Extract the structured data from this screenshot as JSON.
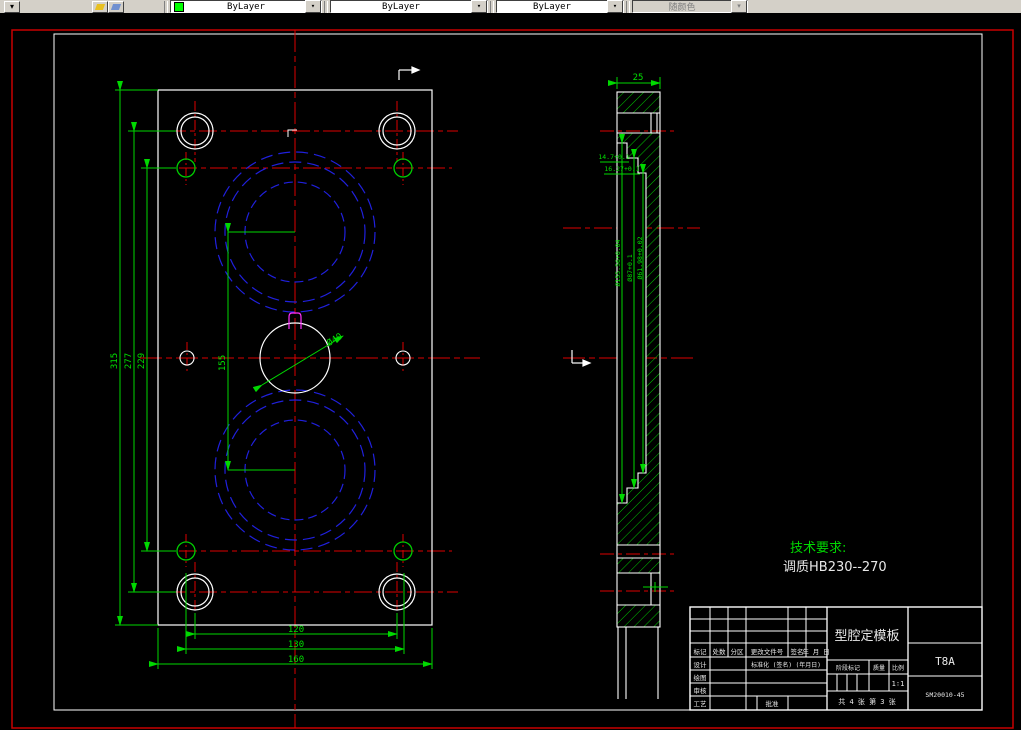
{
  "toolbar": {
    "color_combo": {
      "value": "ByLayer",
      "swatch_color": "#00ff00"
    },
    "linetype_combo": {
      "value": "ByLayer"
    },
    "lineweight_combo": {
      "value": "ByLayer"
    },
    "plotstyle_combo": {
      "value": "随颜色"
    },
    "dropdown_glyph": "▾"
  },
  "drawing": {
    "tech_requirements": {
      "title": "技术要求:",
      "line1": "调质HB230--270"
    },
    "front_view": {
      "dims": {
        "height_overall": "315",
        "height_holes": "277",
        "height_inner": "229",
        "cavity_spacing": "155",
        "width_holes": "120",
        "width_inner": "130",
        "width_overall": "160",
        "center_hole_dia": "Ø40"
      }
    },
    "side_view": {
      "dims": {
        "thickness": "25",
        "depth1": "14.7+0.1",
        "depth2": "16.27+0.1",
        "bore1": "Ø155.56+0.04",
        "bore2": "Ø87+0.1",
        "bore3": "Ø61.98+0.02"
      }
    },
    "title_block": {
      "title": "型腔定模板",
      "material": "T8A",
      "drawing_no": "SM20010-45",
      "header": [
        "标记",
        "处数",
        "分区",
        "更改文件号",
        "签名",
        "年 月 日"
      ],
      "row_design": "设计",
      "row_draw": "绘图",
      "row_check": "审核",
      "row_process": "工艺",
      "standardization": "标准化 (签名) (年月日)",
      "approve": "批准",
      "stage_label": "阶段标记",
      "mass_label": "质量",
      "scale_label": "比例",
      "scale_value": "1∶1",
      "sheet_info": "共 4 张 第 3 张"
    }
  }
}
